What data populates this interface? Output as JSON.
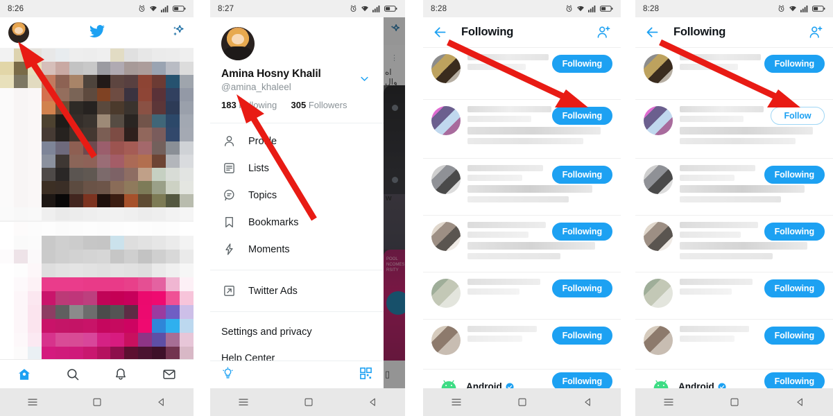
{
  "panels": [
    {
      "id": "home",
      "status": {
        "time": "8:26",
        "icons": [
          "alarm-icon",
          "wifi-icon",
          "signal-icon",
          "battery-icon"
        ]
      },
      "topbar": {
        "avatar": "profile-avatar",
        "logo": "twitter-bird-icon",
        "action": "sparkle-icon"
      },
      "tabbar": [
        {
          "name": "tab-home",
          "icon": "home-icon",
          "active": true
        },
        {
          "name": "tab-search",
          "icon": "search-icon",
          "active": false
        },
        {
          "name": "tab-notifications",
          "icon": "bell-icon",
          "active": false
        },
        {
          "name": "tab-messages",
          "icon": "envelope-icon",
          "active": false
        }
      ],
      "nav": [
        "menu-icon",
        "square-icon",
        "back-triangle-icon"
      ]
    },
    {
      "id": "drawer",
      "status": {
        "time": "8:27"
      },
      "profile": {
        "display_name": "Amina Hosny Khalil",
        "handle": "@amina_khaleel",
        "following_count": "183",
        "following_label": "Following",
        "followers_count": "305",
        "followers_label": "Followers",
        "expand_icon": "chevron-down-icon"
      },
      "menu": [
        {
          "label": "Profile",
          "icon": "person-icon"
        },
        {
          "label": "Lists",
          "icon": "list-icon"
        },
        {
          "label": "Topics",
          "icon": "topics-balloon-icon"
        },
        {
          "label": "Bookmarks",
          "icon": "bookmark-icon"
        },
        {
          "label": "Moments",
          "icon": "lightning-bolt-icon"
        },
        {
          "label": "Twitter Ads",
          "icon": "external-link-icon"
        }
      ],
      "plain_items": [
        {
          "label": "Settings and privacy"
        },
        {
          "label": "Help Center"
        }
      ],
      "footer": {
        "left_icon": "lightbulb-icon",
        "right_icon": "qr-code-icon"
      }
    },
    {
      "id": "following-list",
      "status": {
        "time": "8:28"
      },
      "header": {
        "back_icon": "back-arrow-icon",
        "title": "Following",
        "add_icon": "add-person-icon"
      },
      "rows": [
        {
          "button": "Following",
          "state": "following"
        },
        {
          "button": "Following",
          "state": "following"
        },
        {
          "button": "Following",
          "state": "following"
        },
        {
          "button": "Following",
          "state": "following"
        },
        {
          "button": "Following",
          "state": "following"
        },
        {
          "button": "Following",
          "state": "following"
        }
      ],
      "last_row": {
        "name": "Android",
        "verified": true,
        "badge_icon": "verified-badge-icon",
        "button": "Following"
      }
    },
    {
      "id": "following-list-unfollowed",
      "status": {
        "time": "8:28"
      },
      "header": {
        "back_icon": "back-arrow-icon",
        "title": "Following",
        "add_icon": "add-person-icon"
      },
      "rows": [
        {
          "button": "Following",
          "state": "following"
        },
        {
          "button": "Follow",
          "state": "follow"
        },
        {
          "button": "Following",
          "state": "following"
        },
        {
          "button": "Following",
          "state": "following"
        },
        {
          "button": "Following",
          "state": "following"
        },
        {
          "button": "Following",
          "state": "following"
        }
      ],
      "last_row": {
        "name": "Android",
        "verified": true,
        "badge_icon": "verified-badge-icon",
        "button": "Following"
      }
    }
  ],
  "colors": {
    "twitter_blue": "#1da1f2",
    "arrow_red": "#e81b14",
    "status_bg": "#efefef",
    "navbar_bg": "#e8e8e8",
    "text_dark": "#0f1419",
    "text_muted": "#8a9297"
  },
  "annotations": [
    {
      "name": "arrow-to-avatar",
      "panel": "home"
    },
    {
      "name": "arrow-to-following-count",
      "panel": "drawer"
    },
    {
      "name": "arrow-to-following-button",
      "panel": "following-list"
    },
    {
      "name": "arrow-to-follow-button",
      "panel": "following-list-unfollowed"
    }
  ]
}
